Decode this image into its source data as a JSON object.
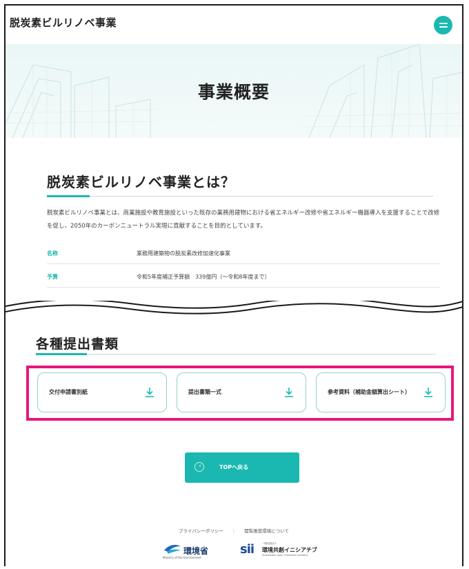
{
  "header": {
    "site_title": "脱炭素ビルリノベ事業"
  },
  "hero": {
    "title": "事業概要"
  },
  "about": {
    "title": "脱炭素ビルリノベ事業とは？",
    "description": "脱炭素ビルリノベ事業とは、商業施設や教育施設といった既存の業務用建物における省エネルギー改修や省エネルギー機器導入を支援することで改修を促し、2050年のカーボンニュートラル実現に貢献することを目的としています。",
    "rows": [
      {
        "label": "名称",
        "value": "業務用建築物の脱炭素改修加速化事業"
      },
      {
        "label": "予算",
        "value": "令和5年度補正予算額　339億円（～令和8年度まで）"
      }
    ]
  },
  "docs": {
    "title": "各種提出書類",
    "buttons": [
      {
        "label": "交付申請書別紙",
        "icon": "download-icon"
      },
      {
        "label": "提出書類一式",
        "icon": "download-icon"
      },
      {
        "label": "参考資料（補助金額算出シート）",
        "icon": "download-icon"
      }
    ]
  },
  "back": {
    "label": "TOPへ戻る"
  },
  "footer": {
    "privacy": "プライバシーポリシー",
    "separator": "|",
    "env_notice": "閲覧推奨環境について",
    "logo_env": {
      "name": "環境省",
      "sub": "Ministry of the Environment"
    },
    "logo_sii": {
      "mark": "sii",
      "small": "一般社団法人",
      "name": "環境共創イニシアチブ",
      "sub": "Sustainable open Innovation Initiative"
    }
  },
  "colors": {
    "accent": "#1ab8b0",
    "highlight": "#e5177d"
  }
}
